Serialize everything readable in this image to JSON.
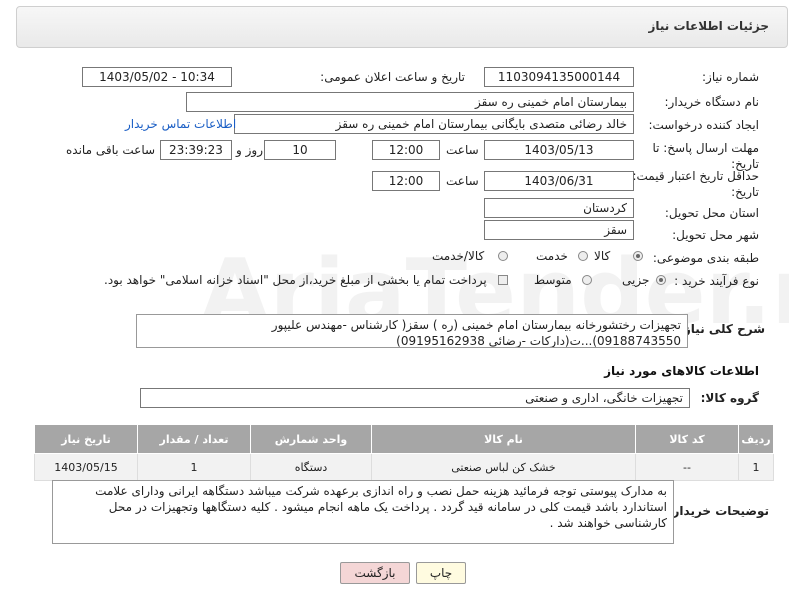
{
  "header": {
    "title": "جزئیات اطلاعات نیاز"
  },
  "labels": {
    "need_no": "شماره نیاز:",
    "announce_dt": "تاریخ و ساعت اعلان عمومی:",
    "buyer_org": "نام دستگاه خریدار:",
    "creator": "ایجاد کننده درخواست:",
    "deadline": "مهلت ارسال پاسخ: تا تاریخ:",
    "min_validity": "حداقل تاریخ اعتبار قیمت: تا تاریخ:",
    "time": "ساعت",
    "day_and": "روز و",
    "remaining": "ساعت باقی مانده",
    "province": "استان محل تحویل:",
    "city": "شهر محل تحویل:",
    "category": "طبقه بندی موضوعی:",
    "process": "نوع فرآیند خرید :",
    "description": "شرح کلی نیاز:",
    "goods_info": "اطلاعات کالاهای مورد نیاز",
    "goods_group": "گروه کالا:",
    "buyer_notes": "توضیحات خریدار:"
  },
  "values": {
    "need_no": "1103094135000144",
    "announce_dt": "1403/05/02 - 10:34",
    "buyer_org": "بیمارستان امام خمینی  ره  سقز",
    "creator": "خالد رضائی متصدی بایگانی بیمارستان امام خمینی  ره  سقز",
    "contact_link": "اطلاعات تماس خریدار",
    "deadline_date": "1403/05/13",
    "deadline_time": "12:00",
    "days": "10",
    "remaining_time": "23:39:23",
    "validity_date": "1403/06/31",
    "validity_time": "12:00",
    "province": "کردستان",
    "city": "سقز",
    "description": "تجهیزات رختشورخانه بیمارستان امام خمینی (ره ) سقز( کارشناس -مهندس علیپور 09188743550)...ت(دارکات -رضائی 09195162938)",
    "goods_group": "تجهیزات خانگی، اداری و صنعتی",
    "buyer_notes": "به مدارک پیوستی توجه فرمائید  هزینه حمل نصب و راه اندازی برعهده شرکت میباشد دستگاهه ایرانی ودارای علامت استاندارد باشد قیمت کلی در سامانه قید گردد . پرداخت یک ماهه انجام میشود . کلیه دستگاهها وتجهیزات در محل کارشناسی خواهند شد ."
  },
  "category_options": [
    "کالا",
    "خدمت",
    "کالا/خدمت"
  ],
  "category_selected": "کالا",
  "process_options": [
    "جزیی",
    "متوسط"
  ],
  "process_selected": "جزیی",
  "process_note": "پرداخت تمام یا بخشی از مبلغ خرید،از محل \"اسناد خزانه اسلامی\" خواهد بود.",
  "table": {
    "headers": [
      "ردیف",
      "کد کالا",
      "نام کالا",
      "واحد شمارش",
      "تعداد / مقدار",
      "تاریخ نیاز"
    ],
    "rows": [
      [
        "1",
        "--",
        "خشک کن لباس صنعتی",
        "دستگاه",
        "1",
        "1403/05/15"
      ]
    ]
  },
  "buttons": {
    "print": "چاپ",
    "back": "بازگشت"
  },
  "watermark": "AriaTender.net",
  "colors": {
    "table_header": "#a6a6a6",
    "link": "#1a5ec5",
    "back_button": "#f4d6d6"
  }
}
